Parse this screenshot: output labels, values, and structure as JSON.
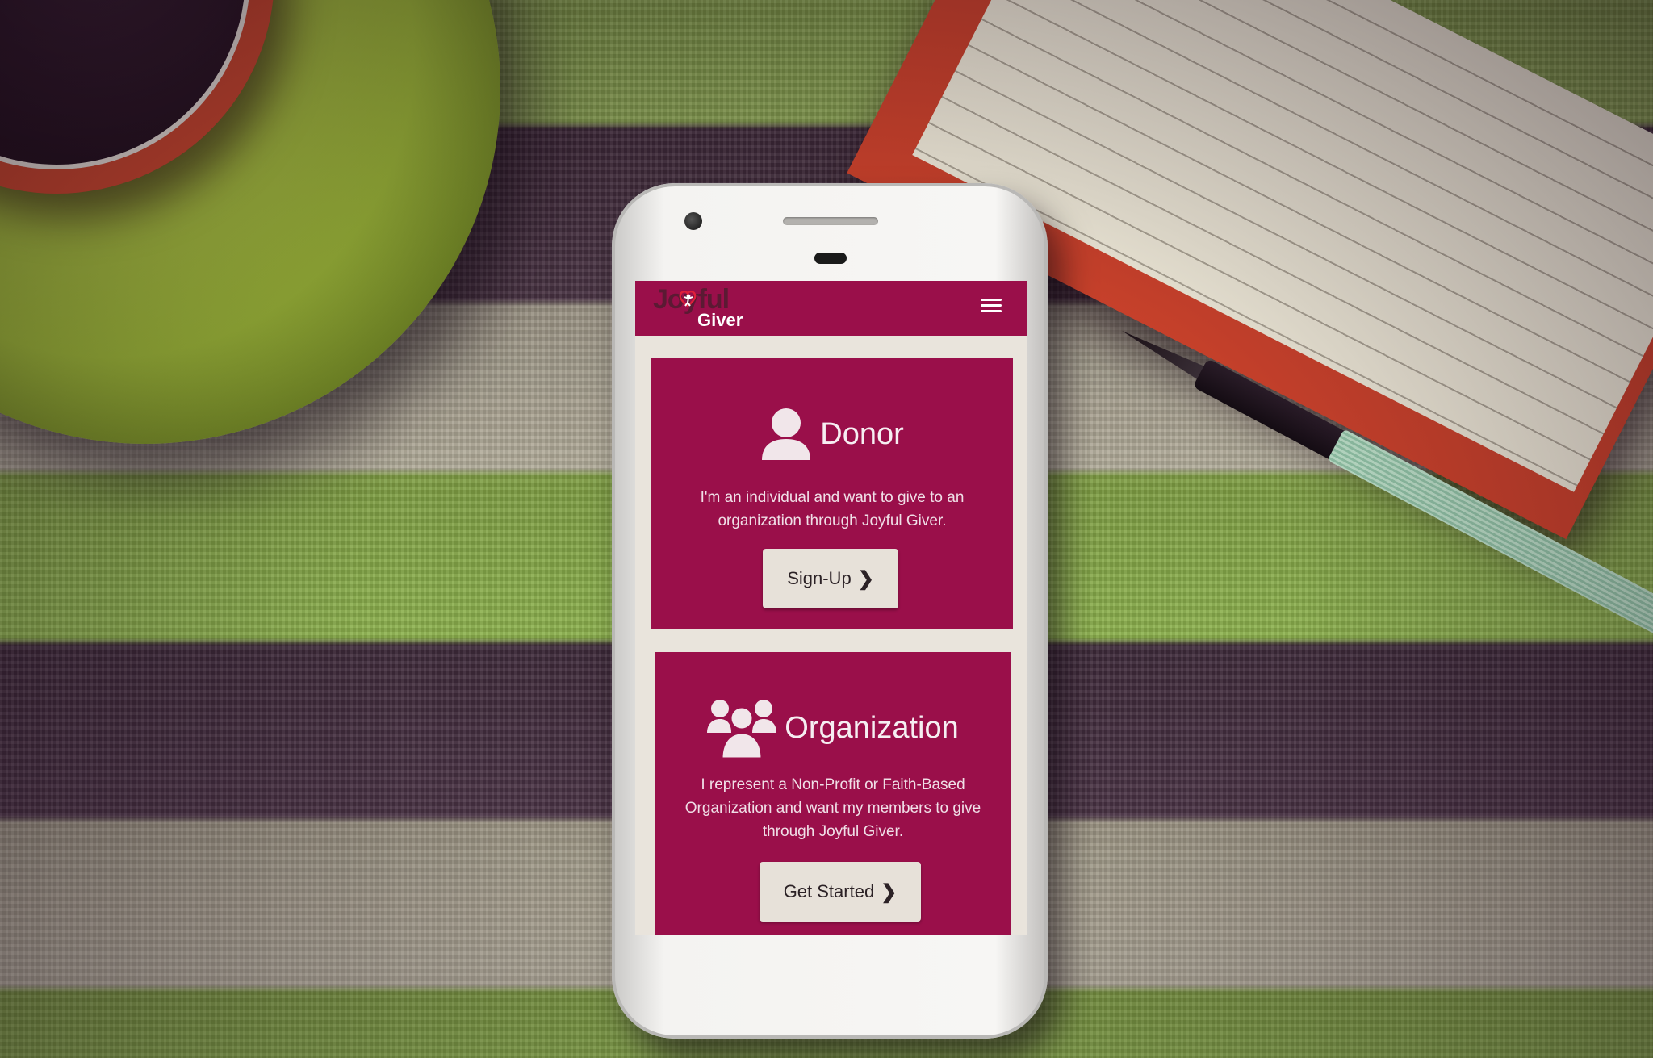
{
  "app": {
    "logo_line1": "Joyful",
    "logo_line2": "Giver"
  },
  "header": {
    "menu_icon": "hamburger-menu-icon"
  },
  "donor_card": {
    "icon": "user-icon",
    "title": "Donor",
    "description": "I'm an individual and want to give to an organization through Joyful Giver.",
    "button_label": "Sign-Up",
    "button_icon": "chevron-right-icon"
  },
  "organization_card": {
    "icon": "users-group-icon",
    "title": "Organization",
    "description": "I represent a Non-Profit or Faith-Based Organization and want my members to give through Joyful Giver.",
    "button_label": "Get Started",
    "button_icon": "chevron-right-icon"
  },
  "colors": {
    "brand_primary": "#9a0f4a",
    "screen_background": "#e9e4dc",
    "button_background": "#e7e1d9"
  }
}
